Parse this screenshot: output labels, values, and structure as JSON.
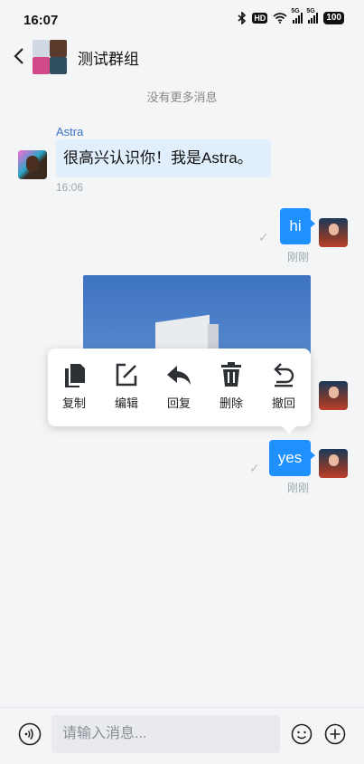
{
  "status_bar": {
    "time": "16:07",
    "network_5g": "5G",
    "battery": "100"
  },
  "header": {
    "title": "测试群组"
  },
  "chat": {
    "no_more": "没有更多消息",
    "messages": [
      {
        "sender": "Astra",
        "text": "很高兴认识你！我是Astra。",
        "time": "16:06"
      },
      {
        "text": "hi",
        "status": "刚刚"
      },
      {
        "type": "image"
      },
      {
        "text": "yes",
        "status": "刚刚"
      }
    ]
  },
  "context_menu": {
    "items": [
      {
        "label": "复制",
        "icon": "copy-icon"
      },
      {
        "label": "编辑",
        "icon": "edit-icon"
      },
      {
        "label": "回复",
        "icon": "reply-icon"
      },
      {
        "label": "删除",
        "icon": "delete-icon"
      },
      {
        "label": "撤回",
        "icon": "undo-icon"
      }
    ]
  },
  "input_bar": {
    "placeholder": "请输入消息..."
  },
  "colors": {
    "accent": "#1e90ff",
    "incoming_bubble": "#e1effd",
    "sender_name": "#3d74c8"
  }
}
